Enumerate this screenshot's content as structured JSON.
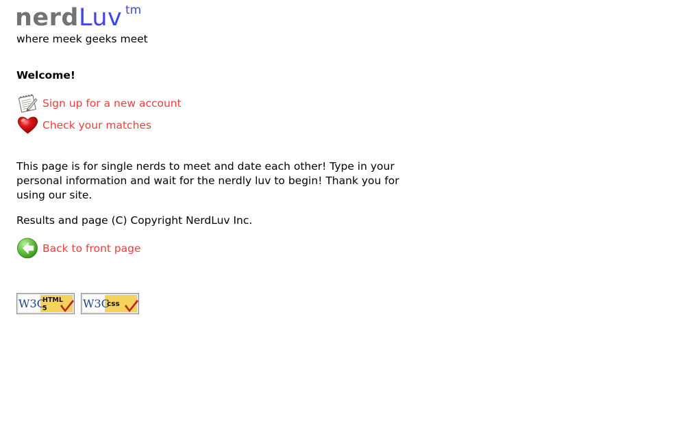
{
  "banner": {
    "logo_part1": "nerd",
    "logo_part2": "Luv",
    "logo_tm": "tm",
    "tagline": "where meek geeks meet"
  },
  "welcome": "Welcome!",
  "links": {
    "signup": {
      "label": "Sign up for a new account",
      "icon": "signup-notepad-icon"
    },
    "matches": {
      "label": "Check your matches",
      "icon": "heart-icon"
    },
    "back": {
      "label": "Back to front page",
      "icon": "back-arrow-icon"
    }
  },
  "content": {
    "intro": "This page is for single nerds to meet and date each other! Type in your personal information and wait for the nerdly luv to begin! Thank you for using our site.",
    "copyright": "Results and page (C) Copyright NerdLuv Inc."
  },
  "badges": {
    "html": {
      "w3c": "W3C",
      "line1": "HTML",
      "line2": "5"
    },
    "css": {
      "w3c": "W3C",
      "line1": "css"
    }
  },
  "colors": {
    "link": "#e8413d",
    "logo_gray": "#737373",
    "logo_blue": "#3f48e6",
    "badge_yellow": "#f4d25b",
    "check_red": "#b8261c"
  }
}
